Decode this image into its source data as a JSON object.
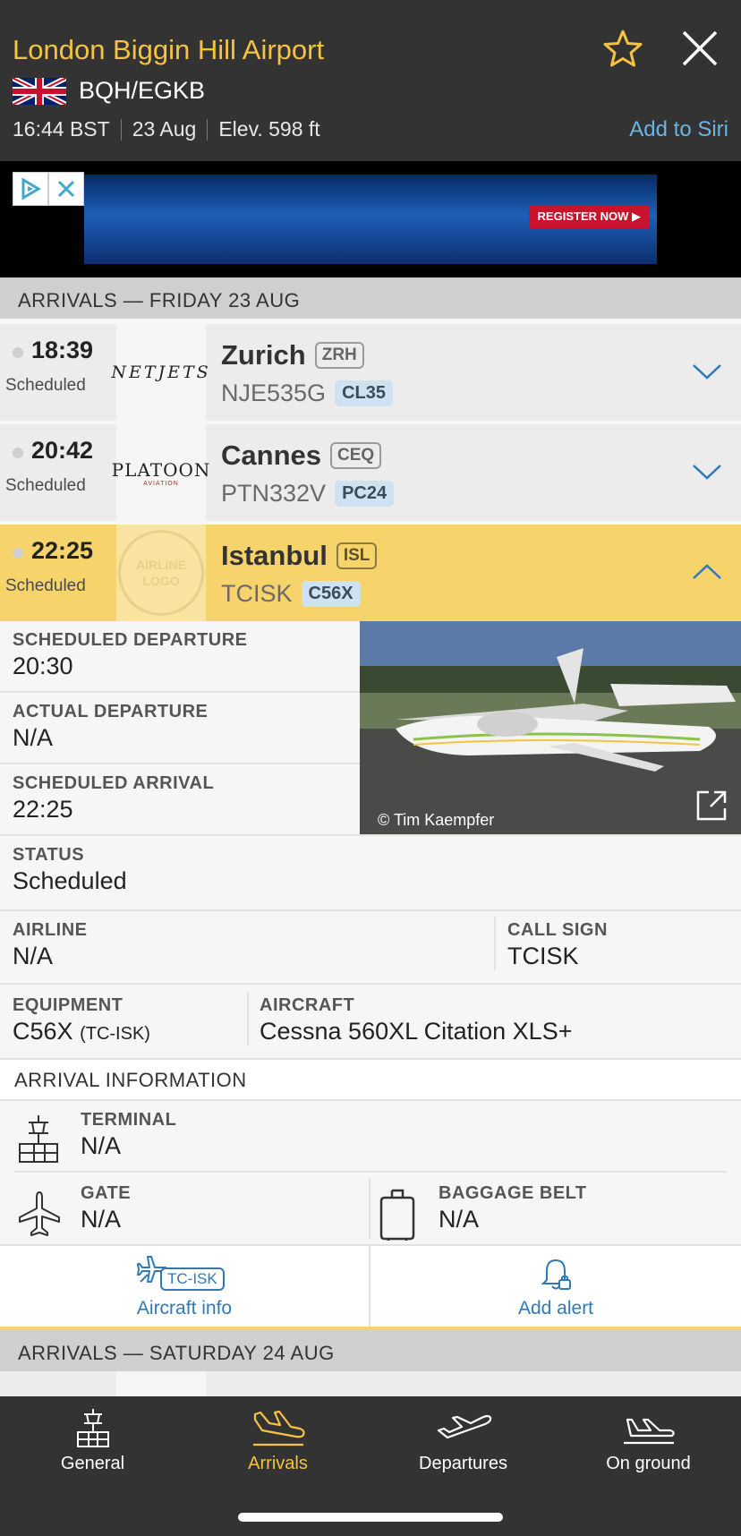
{
  "header": {
    "title": "London Biggin Hill Airport",
    "codes": "BQH/EGKB",
    "time": "16:44 BST",
    "date": "23 Aug",
    "elevation": "Elev. 598 ft",
    "add_to_siri": "Add to Siri"
  },
  "ad": {
    "cta": "REGISTER NOW ▶"
  },
  "sections": {
    "friday": "ARRIVALS — FRIDAY 23 AUG",
    "saturday": "ARRIVALS — SATURDAY 24 AUG"
  },
  "flights": [
    {
      "time": "18:39",
      "status": "Scheduled",
      "airline_logo": "NETJETS",
      "destination": "Zurich",
      "iata": "ZRH",
      "flight": "NJE535G",
      "type": "CL35"
    },
    {
      "time": "20:42",
      "status": "Scheduled",
      "airline_logo": "PLATOON",
      "airline_logo_sub": "AVIATION",
      "destination": "Cannes",
      "iata": "CEQ",
      "flight": "PTN332V",
      "type": "PC24"
    },
    {
      "time": "22:25",
      "status": "Scheduled",
      "airline_logo": "AIRLINE LOGO",
      "destination": "Istanbul",
      "iata": "ISL",
      "flight": "TCISK",
      "type": "C56X"
    }
  ],
  "details": {
    "scheduled_departure": {
      "label": "SCHEDULED DEPARTURE",
      "value": "20:30"
    },
    "actual_departure": {
      "label": "ACTUAL DEPARTURE",
      "value": "N/A"
    },
    "scheduled_arrival": {
      "label": "SCHEDULED ARRIVAL",
      "value": "22:25"
    },
    "status": {
      "label": "STATUS",
      "value": "Scheduled"
    },
    "airline": {
      "label": "AIRLINE",
      "value": "N/A"
    },
    "call_sign": {
      "label": "CALL SIGN",
      "value": "TCISK"
    },
    "equipment": {
      "label": "EQUIPMENT",
      "value": "C56X",
      "reg": "(TC-ISK)"
    },
    "aircraft": {
      "label": "AIRCRAFT",
      "value": "Cessna 560XL Citation XLS+"
    },
    "photo_credit": "© Tim Kaempfer",
    "arrival_info_header": "ARRIVAL INFORMATION",
    "terminal": {
      "label": "TERMINAL",
      "value": "N/A"
    },
    "gate": {
      "label": "GATE",
      "value": "N/A"
    },
    "baggage_belt": {
      "label": "BAGGAGE BELT",
      "value": "N/A"
    },
    "aircraft_info": {
      "reg_tag": "TC-ISK",
      "label": "Aircraft info"
    },
    "add_alert": {
      "label": "Add alert"
    }
  },
  "tabs": [
    {
      "label": "General",
      "icon": "tower-icon"
    },
    {
      "label": "Arrivals",
      "icon": "arrivals-plane-icon",
      "active": true
    },
    {
      "label": "Departures",
      "icon": "departures-plane-icon"
    },
    {
      "label": "On ground",
      "icon": "on-ground-plane-icon"
    }
  ],
  "colors": {
    "accent": "#f6c242",
    "header_bg": "#333333",
    "expanded_row": "#f6d46b",
    "link": "#2f79b9"
  }
}
